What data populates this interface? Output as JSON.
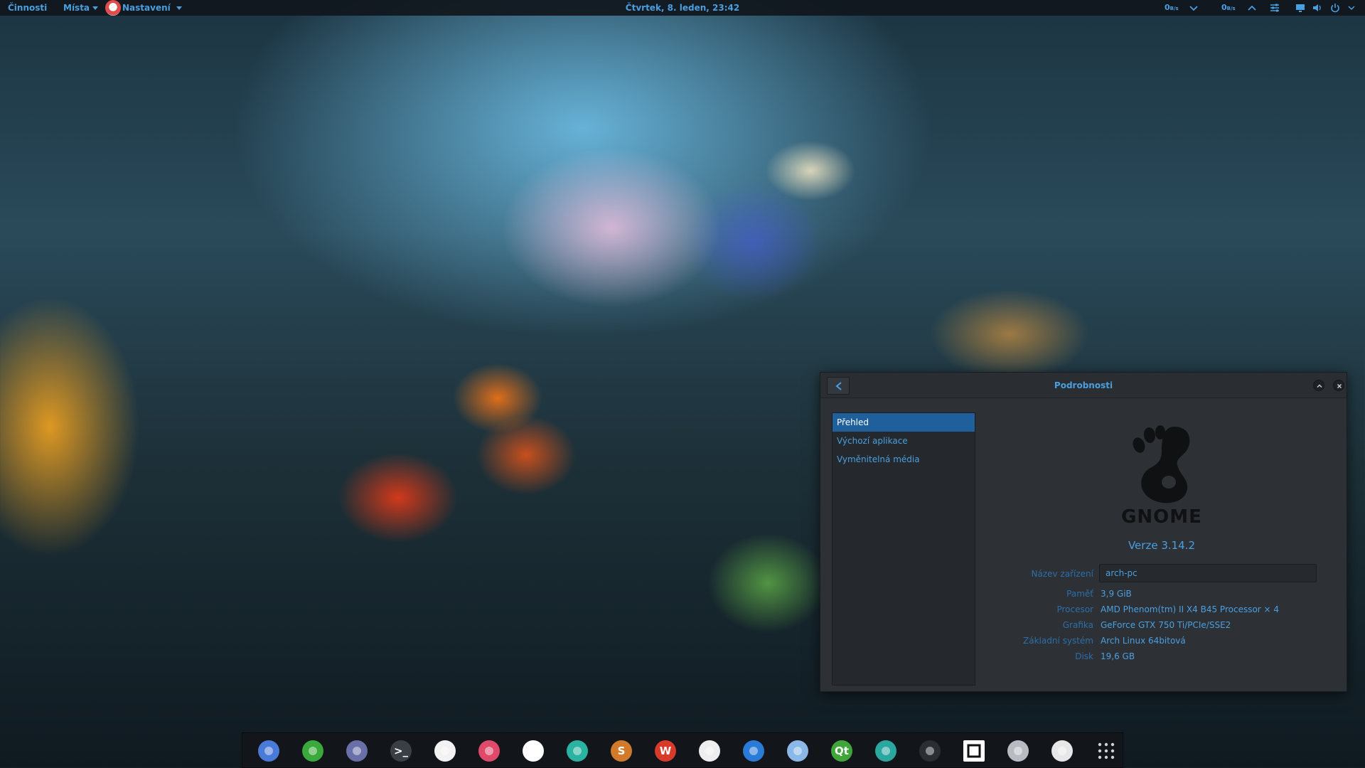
{
  "topbar": {
    "activities": "Činnosti",
    "places": "Místa",
    "settings_app": "Nastavení",
    "clock": "Čtvrtek,  8. leden, 23:42",
    "net_down_1": "0",
    "net_unit_1": "B/s",
    "net_down_2": "0",
    "net_unit_2": "B/s",
    "tray_icons": [
      "chevron-down-icon",
      "chevron-up-icon",
      "sliders-icon",
      "display-icon",
      "volume-icon",
      "power-icon"
    ]
  },
  "window": {
    "title": "Podrobnosti",
    "sidebar": [
      {
        "label": "Přehled",
        "active": true
      },
      {
        "label": "Výchozí aplikace",
        "active": false
      },
      {
        "label": "Vyměnitelná média",
        "active": false
      }
    ],
    "logo_text": "GNOME",
    "version": "Verze 3.14.2",
    "device_name": {
      "label": "Název zařízení",
      "value": "arch-pc"
    },
    "details": [
      {
        "label": "Paměť",
        "value": "3,9 GiB"
      },
      {
        "label": "Procesor",
        "value": "AMD Phenom(tm) II X4 B45 Processor × 4"
      },
      {
        "label": "Grafika",
        "value": "GeForce GTX 750 Ti/PCIe/SSE2"
      },
      {
        "label": "Základní systém",
        "value": "Arch Linux 64bitová"
      },
      {
        "label": "Disk",
        "value": "19,6 GB"
      }
    ]
  },
  "dock": {
    "apps": [
      {
        "name": "chromium-icon",
        "glyph": "",
        "color": "#4a7ad8"
      },
      {
        "name": "evernote-icon",
        "glyph": "",
        "color": "#3aa83a"
      },
      {
        "name": "files-icon",
        "glyph": "",
        "color": "#6a6fa8"
      },
      {
        "name": "terminal-icon",
        "glyph": ">_",
        "color": "#3a3f45"
      },
      {
        "name": "media-player-icon",
        "glyph": "",
        "color": "#f2f2f2"
      },
      {
        "name": "lollypop-icon",
        "glyph": "",
        "color": "#e04a6a"
      },
      {
        "name": "video-icon",
        "glyph": "",
        "color": "#ffffff"
      },
      {
        "name": "system-monitor-icon",
        "glyph": "",
        "color": "#2ab3a0"
      },
      {
        "name": "sublime-text-icon",
        "glyph": "S",
        "color": "#d07a2a"
      },
      {
        "name": "wps-writer-icon",
        "glyph": "W",
        "color": "#d83a2a"
      },
      {
        "name": "feather-icon",
        "glyph": "",
        "color": "#eeeeee"
      },
      {
        "name": "no-entry-icon",
        "glyph": "",
        "color": "#2a7ad8"
      },
      {
        "name": "snowflake-icon",
        "glyph": "",
        "color": "#8ab8e8"
      },
      {
        "name": "qt-creator-icon",
        "glyph": "Qt",
        "color": "#41a63a"
      },
      {
        "name": "home-icon",
        "glyph": "",
        "color": "#2aa8a0"
      },
      {
        "name": "steam-icon",
        "glyph": "",
        "color": "#2a2d31"
      },
      {
        "name": "window-icon",
        "glyph": "",
        "color": "#ffffff"
      },
      {
        "name": "truck-icon",
        "glyph": "",
        "color": "#b8bcc2"
      },
      {
        "name": "toggle-icon",
        "glyph": "",
        "color": "#e7e7e7"
      },
      {
        "name": "app-grid-icon",
        "glyph": "",
        "color": "#cfd3d8"
      }
    ]
  }
}
